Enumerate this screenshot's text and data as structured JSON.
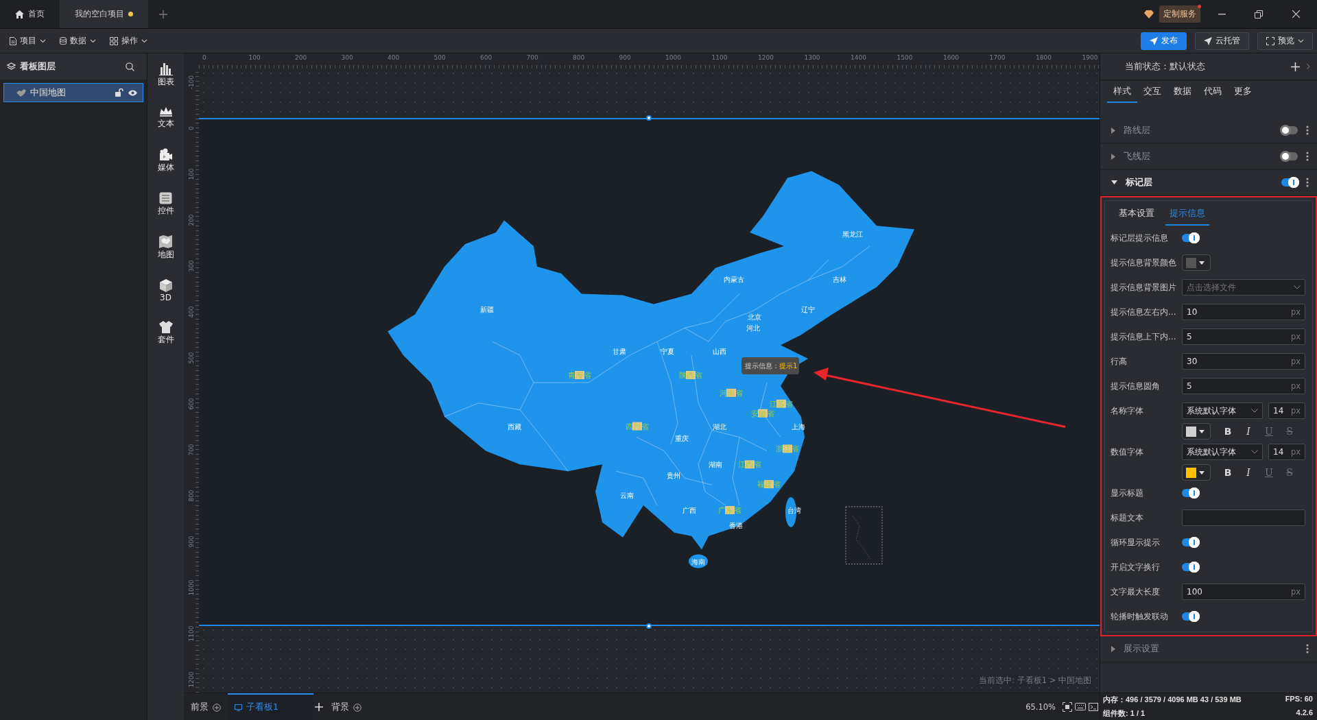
{
  "title_bar": {
    "tabs": [
      {
        "label": "首页",
        "kind": "home",
        "selected": false,
        "unsaved": false
      },
      {
        "label": "我的空白项目",
        "kind": "project",
        "selected": true,
        "unsaved": true
      }
    ],
    "service_badge": "定制服务"
  },
  "menu": [
    {
      "label": "项目",
      "kind": "file"
    },
    {
      "label": "数据",
      "kind": "database"
    },
    {
      "label": "操作",
      "kind": "grid"
    }
  ],
  "actions": [
    {
      "label": "发布",
      "kind": "primary"
    },
    {
      "label": "云托管",
      "kind": "cloud"
    },
    {
      "label": "预览",
      "kind": "preview"
    }
  ],
  "layers_panel": {
    "title": "看板图层",
    "items": [
      {
        "label": "中国地图",
        "selected": true
      }
    ]
  },
  "toolbox": [
    {
      "label": "图表",
      "kind": "chart"
    },
    {
      "label": "文本",
      "kind": "text"
    },
    {
      "label": "媒体",
      "kind": "media"
    },
    {
      "label": "控件",
      "kind": "control"
    },
    {
      "label": "地图",
      "kind": "map"
    },
    {
      "label": "3D",
      "kind": "cube"
    },
    {
      "label": "套件",
      "kind": "kit"
    }
  ],
  "rulers": {
    "horizontal": [
      "0",
      "100",
      "200",
      "300",
      "400",
      "500",
      "600",
      "700",
      "800",
      "900",
      "1000",
      "1100",
      "1200",
      "1300",
      "1400",
      "1500",
      "1600",
      "1700",
      "1800",
      "1900"
    ],
    "vertical": [
      "-100",
      "0",
      "100",
      "200",
      "300",
      "400",
      "500",
      "600",
      "700",
      "800",
      "900",
      "1000",
      "1100",
      "1200"
    ]
  },
  "map": {
    "regions": [
      {
        "name": "黑龙江",
        "marked": false
      },
      {
        "name": "内蒙古",
        "marked": false
      },
      {
        "name": "吉林",
        "marked": false
      },
      {
        "name": "新疆",
        "marked": false
      },
      {
        "name": "辽宁",
        "marked": false
      },
      {
        "name": "北京",
        "marked": false
      },
      {
        "name": "河北",
        "marked": false
      },
      {
        "name": "甘肃",
        "marked": false
      },
      {
        "name": "宁夏",
        "marked": false
      },
      {
        "name": "山西",
        "marked": false
      },
      {
        "name": "青海省",
        "marked": true
      },
      {
        "name": "陕西省",
        "marked": true
      },
      {
        "name": "河南省",
        "marked": true
      },
      {
        "name": "江苏省",
        "marked": true
      },
      {
        "name": "安徽省",
        "marked": true
      },
      {
        "name": "西藏",
        "marked": false
      },
      {
        "name": "四川省",
        "marked": true
      },
      {
        "name": "湖北",
        "marked": false
      },
      {
        "name": "上海",
        "marked": false
      },
      {
        "name": "重庆",
        "marked": false
      },
      {
        "name": "浙江省",
        "marked": true
      },
      {
        "name": "湖南",
        "marked": false
      },
      {
        "name": "江西省",
        "marked": true
      },
      {
        "name": "贵州",
        "marked": false
      },
      {
        "name": "福建省",
        "marked": true
      },
      {
        "name": "云南",
        "marked": false
      },
      {
        "name": "广西",
        "marked": false
      },
      {
        "name": "广东省",
        "marked": true
      },
      {
        "name": "台湾",
        "marked": false
      },
      {
        "name": "香港",
        "marked": false
      },
      {
        "name": "海南",
        "marked": false
      }
    ],
    "tooltip": {
      "label": "提示信息：",
      "value": "提示1"
    }
  },
  "selection_path": "当前选中: 子看板1 > 中国地图",
  "board_tabs": [
    {
      "label": "前景",
      "selected": false
    },
    {
      "label": "子看板1",
      "selected": true
    },
    {
      "label": "背景",
      "selected": false
    }
  ],
  "zoom": "65.10%",
  "properties": {
    "state": "当前状态：默认状态",
    "tabs": [
      {
        "label": "样式",
        "selected": true
      },
      {
        "label": "交互",
        "selected": false
      },
      {
        "label": "数据",
        "selected": false
      },
      {
        "label": "代码",
        "selected": false
      },
      {
        "label": "更多",
        "selected": false
      }
    ],
    "layers": [
      {
        "label": "路线层",
        "kind": "layer",
        "on": false,
        "expanded": false
      },
      {
        "label": "飞线层",
        "kind": "layer",
        "on": false,
        "expanded": false
      },
      {
        "label": "标记层",
        "kind": "layer",
        "on": true,
        "expanded": true
      },
      {
        "label": "展示设置",
        "kind": "section",
        "expanded": false
      }
    ],
    "subtabs": [
      {
        "label": "基本设置",
        "selected": false
      },
      {
        "label": "提示信息",
        "selected": true
      }
    ],
    "fields": [
      {
        "kind": "toggle",
        "label": "标记层提示信息",
        "on": true
      },
      {
        "kind": "color",
        "label": "提示信息背景颜色",
        "color": "#555555"
      },
      {
        "kind": "file",
        "label": "提示信息背景图片",
        "placeholder": "点击选择文件"
      },
      {
        "kind": "number",
        "label": "提示信息左右内...",
        "value": "10",
        "unit": "px"
      },
      {
        "kind": "number",
        "label": "提示信息上下内...",
        "value": "5",
        "unit": "px"
      },
      {
        "kind": "number",
        "label": "行高",
        "value": "30",
        "unit": "px"
      },
      {
        "kind": "number",
        "label": "提示信息圆角",
        "value": "5",
        "unit": "px"
      },
      {
        "kind": "font",
        "label": "名称字体",
        "font": "系统默认字体",
        "size": "14",
        "unit": "px",
        "color": "#d0d0d0",
        "styles": [
          {
            "label": "B",
            "kind": "bold",
            "active": true
          },
          {
            "label": "I",
            "kind": "italic",
            "active": true
          },
          {
            "label": "U",
            "kind": "underline",
            "active": false
          },
          {
            "label": "S",
            "kind": "strike",
            "active": false
          }
        ]
      },
      {
        "kind": "font",
        "label": "数值字体",
        "font": "系统默认字体",
        "size": "14",
        "unit": "px",
        "color": "#ffc000",
        "styles": [
          {
            "label": "B",
            "kind": "bold",
            "active": true
          },
          {
            "label": "I",
            "kind": "italic",
            "active": true
          },
          {
            "label": "U",
            "kind": "underline",
            "active": false
          },
          {
            "label": "S",
            "kind": "strike",
            "active": false
          }
        ]
      },
      {
        "kind": "toggle",
        "label": "显示标题",
        "on": true
      },
      {
        "kind": "text",
        "label": "标题文本"
      },
      {
        "kind": "toggle",
        "label": "循环显示提示",
        "on": true
      },
      {
        "kind": "toggle",
        "label": "开启文字换行",
        "on": true
      },
      {
        "kind": "number",
        "label": "文字最大长度",
        "value": "100",
        "unit": "px"
      },
      {
        "kind": "toggle",
        "label": "轮播时触发联动",
        "on": true
      }
    ]
  },
  "status": {
    "memory": "内存：496 / 3579 / 4096 MB  43 / 539 MB",
    "fps": "FPS:  60",
    "components": "组件数: 1 / 1",
    "version": "4.2.6"
  }
}
